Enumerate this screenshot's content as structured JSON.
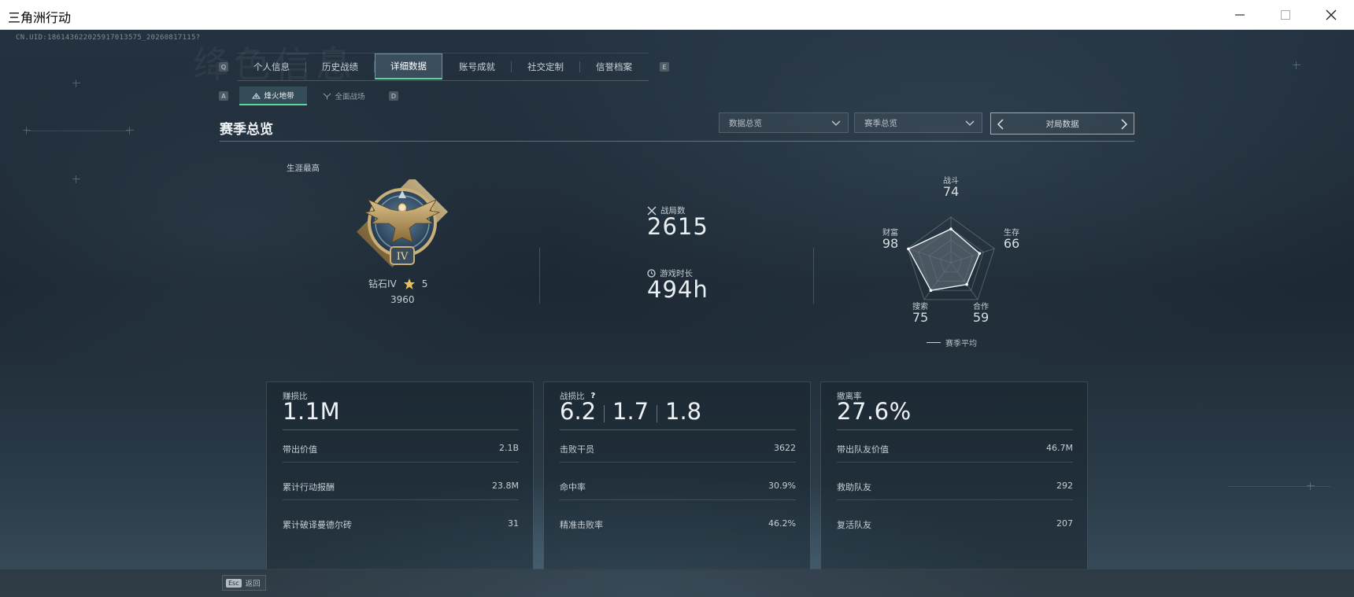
{
  "window": {
    "title": "三角洲行动"
  },
  "uid": "CN.UID:186143622025917013575_20260817115?",
  "bg_word": "绛色信息",
  "tab_keys": {
    "left": "Q",
    "right": "E"
  },
  "tabs": [
    {
      "label": "个人信息",
      "active": false
    },
    {
      "label": "历史战绩",
      "active": false
    },
    {
      "label": "详细数据",
      "active": true
    },
    {
      "label": "账号成就",
      "active": false
    },
    {
      "label": "社交定制",
      "active": false
    },
    {
      "label": "信誉档案",
      "active": false
    }
  ],
  "subtab_keys": {
    "left": "A",
    "right": "D"
  },
  "subtabs": [
    {
      "label": "烽火地带",
      "active": true,
      "icon": "fire-zone-icon"
    },
    {
      "label": "全面战场",
      "active": false,
      "icon": "battlefield-icon"
    }
  ],
  "section": {
    "title": "赛季总览"
  },
  "filters": {
    "dropdown1": "数据总览",
    "dropdown2": "赛季总览",
    "pager": "对局数据"
  },
  "career": {
    "label": "生涯最高",
    "rank": "钻石IV",
    "stars": "5",
    "score": "3960",
    "emblem_numeral": "IV"
  },
  "stats": {
    "matches_label": "战局数",
    "matches_value": "2615",
    "playtime_label": "游戏时长",
    "playtime_value": "494h"
  },
  "radar": {
    "axes": [
      {
        "label": "战斗",
        "value": "74",
        "score": 74
      },
      {
        "label": "生存",
        "value": "66",
        "score": 66
      },
      {
        "label": "合作",
        "value": "59",
        "score": 59
      },
      {
        "label": "搜索",
        "value": "75",
        "score": 75
      },
      {
        "label": "财富",
        "value": "98",
        "score": 98
      }
    ],
    "legend": "赛季平均"
  },
  "cards": {
    "profit": {
      "label": "赚损比",
      "big": "1.1M",
      "rows": [
        {
          "k": "带出价值",
          "v": "2.1B"
        },
        {
          "k": "累计行动报酬",
          "v": "23.8M"
        },
        {
          "k": "累计破译曼德尔砖",
          "v": "31"
        }
      ]
    },
    "combat": {
      "label": "战损比",
      "help": "?",
      "ratios": [
        "6.2",
        "1.7",
        "1.8"
      ],
      "rows": [
        {
          "k": "击败干员",
          "v": "3622"
        },
        {
          "k": "命中率",
          "v": "30.9%"
        },
        {
          "k": "精准击败率",
          "v": "46.2%"
        }
      ]
    },
    "extract": {
      "label": "撤离率",
      "big": "27.6%",
      "rows": [
        {
          "k": "带出队友价值",
          "v": "46.7M"
        },
        {
          "k": "救助队友",
          "v": "292"
        },
        {
          "k": "复活队友",
          "v": "207"
        }
      ]
    }
  },
  "footer": {
    "esc_key": "Esc",
    "back_label": "返回"
  },
  "colors": {
    "accent": "#5ad6a2",
    "radar_fill": "#4a5660"
  }
}
